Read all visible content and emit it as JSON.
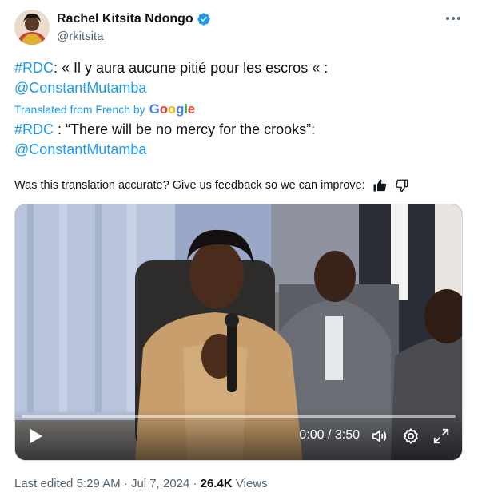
{
  "author": {
    "name": "Rachel Kitsita Ndongo",
    "handle": "@rkitsita"
  },
  "post": {
    "original_hashtag": "#RDC",
    "original_text": ": « Il y aura aucune pitié pour les escros « :",
    "original_mention": "@ConstantMutamba",
    "translated_from": "Translated from French by",
    "google_letters": [
      "G",
      "o",
      "o",
      "g",
      "l",
      "e"
    ],
    "translated_hashtag": "#RDC",
    "translated_text": " : “There will be no mercy for the crooks”:",
    "translated_mention": "@ConstantMutamba"
  },
  "feedback": {
    "prompt": "Was this translation accurate? Give us feedback so we can improve:"
  },
  "video": {
    "current_time": "0:00",
    "duration": "3:50",
    "time_display": "0:00 / 3:50",
    "progress_fraction": 0
  },
  "meta": {
    "edited_label": "Last edited",
    "time": "5:29 AM",
    "separator": "·",
    "date": "Jul 7, 2024",
    "views_count": "26.4K",
    "views_label": "Views"
  },
  "colors": {
    "link": "#1d9bf0",
    "secondary_text": "#536471",
    "verified": "#1d9bf0"
  },
  "icons": [
    "verified-badge-icon",
    "more-icon",
    "thumbs-up-icon",
    "thumbs-down-icon",
    "play-icon",
    "volume-icon",
    "settings-icon",
    "fullscreen-icon"
  ]
}
